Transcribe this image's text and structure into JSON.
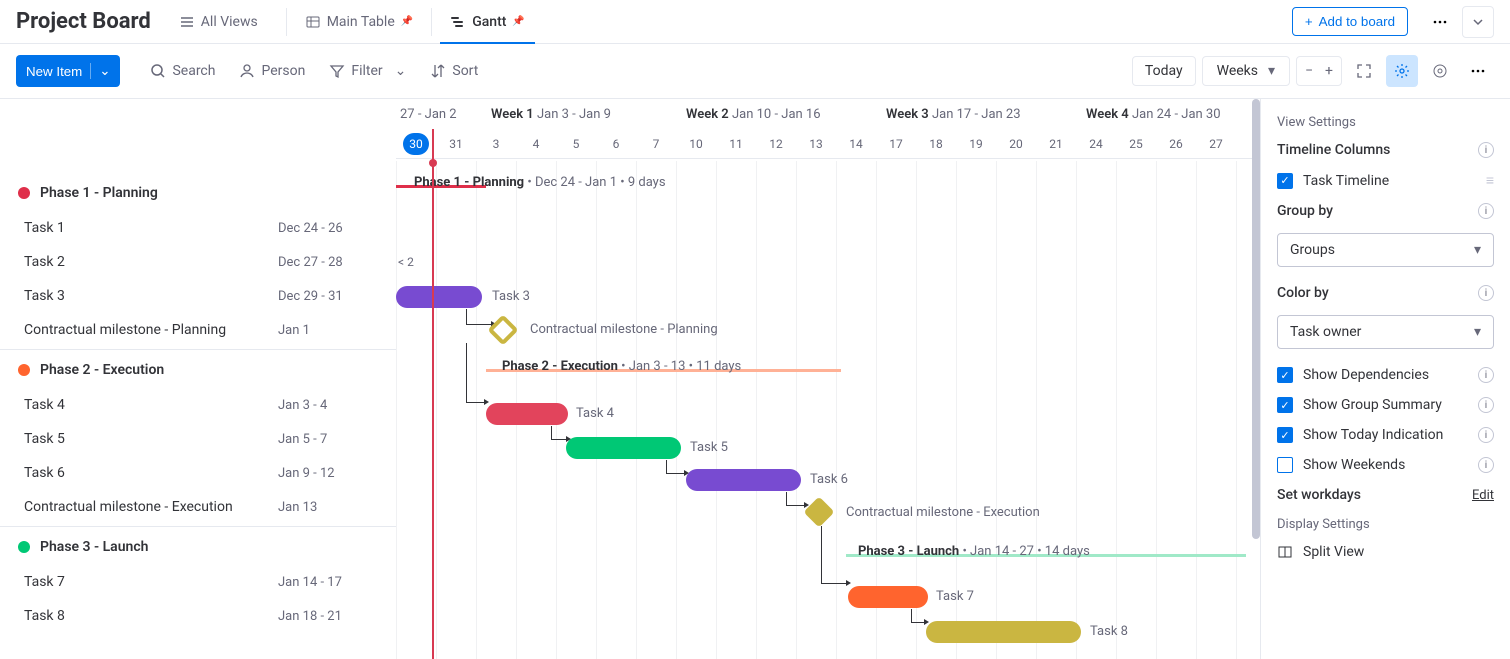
{
  "header": {
    "title": "Project Board",
    "all_views": "All Views",
    "tab_main": "Main Table",
    "tab_gantt": "Gantt",
    "add_to_board": "Add to board"
  },
  "toolbar": {
    "new_item": "New Item",
    "search": "Search",
    "person": "Person",
    "filter": "Filter",
    "sort": "Sort",
    "today": "Today",
    "zoom": "Weeks"
  },
  "timeline": {
    "week0": "27 - Jan 2",
    "week1_b": "Week 1",
    "week1_r": "Jan 3 - Jan 9",
    "week2_b": "Week 2",
    "week2_r": "Jan 10 - Jan 16",
    "week3_b": "Week 3",
    "week3_r": "Jan 17 - Jan 23",
    "week4_b": "Week 4",
    "week4_r": "Jan 24 - Jan 30",
    "days": [
      "30",
      "31",
      "3",
      "4",
      "5",
      "6",
      "7",
      "10",
      "11",
      "12",
      "13",
      "14",
      "17",
      "18",
      "19",
      "20",
      "21",
      "24",
      "25",
      "26",
      "27"
    ]
  },
  "groups": [
    {
      "name": "Phase 1 - Planning",
      "color": "#df2f4a",
      "summary_b": "Phase 1 - Planning",
      "summary_r": "• Dec 24 - Jan 1 • 9 days",
      "tasks": [
        {
          "name": "Task 1",
          "dates": "Dec 24 - 26"
        },
        {
          "name": "Task 2",
          "dates": "Dec 27 - 28"
        },
        {
          "name": "Task 3",
          "dates": "Dec 29 - 31"
        },
        {
          "name": "Contractual milestone - Planning",
          "dates": "Jan 1"
        }
      ]
    },
    {
      "name": "Phase 2 - Execution",
      "color": "#ff642e",
      "summary_b": "Phase 2 - Execution",
      "summary_r": "• Jan 3 - 13 • 11 days",
      "tasks": [
        {
          "name": "Task 4",
          "dates": "Jan 3 - 4"
        },
        {
          "name": "Task 5",
          "dates": "Jan 5 - 7"
        },
        {
          "name": "Task 6",
          "dates": "Jan 9 - 12"
        },
        {
          "name": "Contractual milestone - Execution",
          "dates": "Jan 13"
        }
      ]
    },
    {
      "name": "Phase 3 - Launch",
      "color": "#00c875",
      "summary_b": "Phase 3 - Launch",
      "summary_r": "• Jan 14 - 27 • 14 days",
      "tasks": [
        {
          "name": "Task 7",
          "dates": "Jan 14 - 17"
        },
        {
          "name": "Task 8",
          "dates": "Jan 18 - 21"
        }
      ]
    }
  ],
  "cut_label": "< 2",
  "bars": {
    "task3": "Task 3",
    "milestone1": "Contractual milestone - Planning",
    "task4": "Task 4",
    "task5": "Task 5",
    "task6": "Task 6",
    "milestone2": "Contractual milestone - Execution",
    "task7": "Task 7",
    "task8": "Task 8"
  },
  "settings": {
    "title": "View Settings",
    "timeline_cols": "Timeline Columns",
    "task_timeline": "Task Timeline",
    "group_by": "Group by",
    "group_by_val": "Groups",
    "color_by": "Color by",
    "color_by_val": "Task owner",
    "show_deps": "Show Dependencies",
    "show_summary": "Show Group Summary",
    "show_today": "Show Today Indication",
    "show_weekends": "Show Weekends",
    "set_workdays": "Set workdays",
    "edit": "Edit",
    "display": "Display Settings",
    "split_view": "Split View"
  }
}
